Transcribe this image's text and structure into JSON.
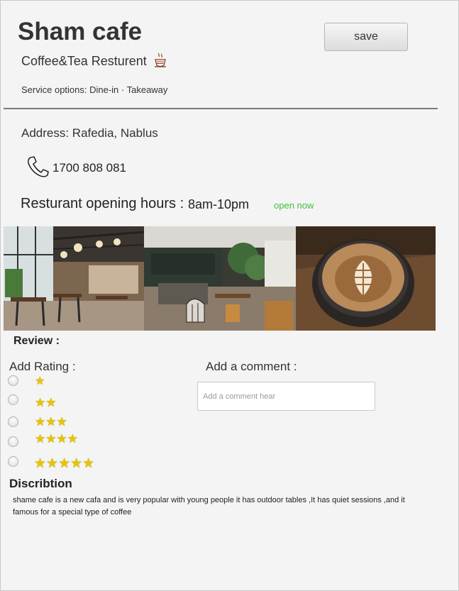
{
  "header": {
    "title": "Sham cafe",
    "save_label": "save",
    "subtitle": "Coffee&Tea Resturent",
    "service_options": "Service options: Dine-in · Takeaway"
  },
  "info": {
    "address": "Address: Rafedia, Nablus",
    "phone": "1700 808 081",
    "hours_label": "Resturant opening hours :",
    "hours_value": "8am-10pm",
    "status": "open now",
    "status_color": "#3fbf3f"
  },
  "review": {
    "heading": "Review :",
    "rating_label": "Add Rating :",
    "ratings": [
      "★",
      "★★",
      "★★★",
      "★★★★",
      "★★★★★"
    ],
    "comment_label": "Add a comment :",
    "comment_placeholder": "Add a comment hear",
    "comment_value": ""
  },
  "description": {
    "heading": "Discribtion",
    "text": "shame cafe is a new cafa and is very popular with young people it has outdoor tables ,It has quiet sessions ,and it famous for a special type of coffee"
  },
  "icons": {
    "coffee": "coffee-cup-icon",
    "phone": "phone-icon"
  }
}
